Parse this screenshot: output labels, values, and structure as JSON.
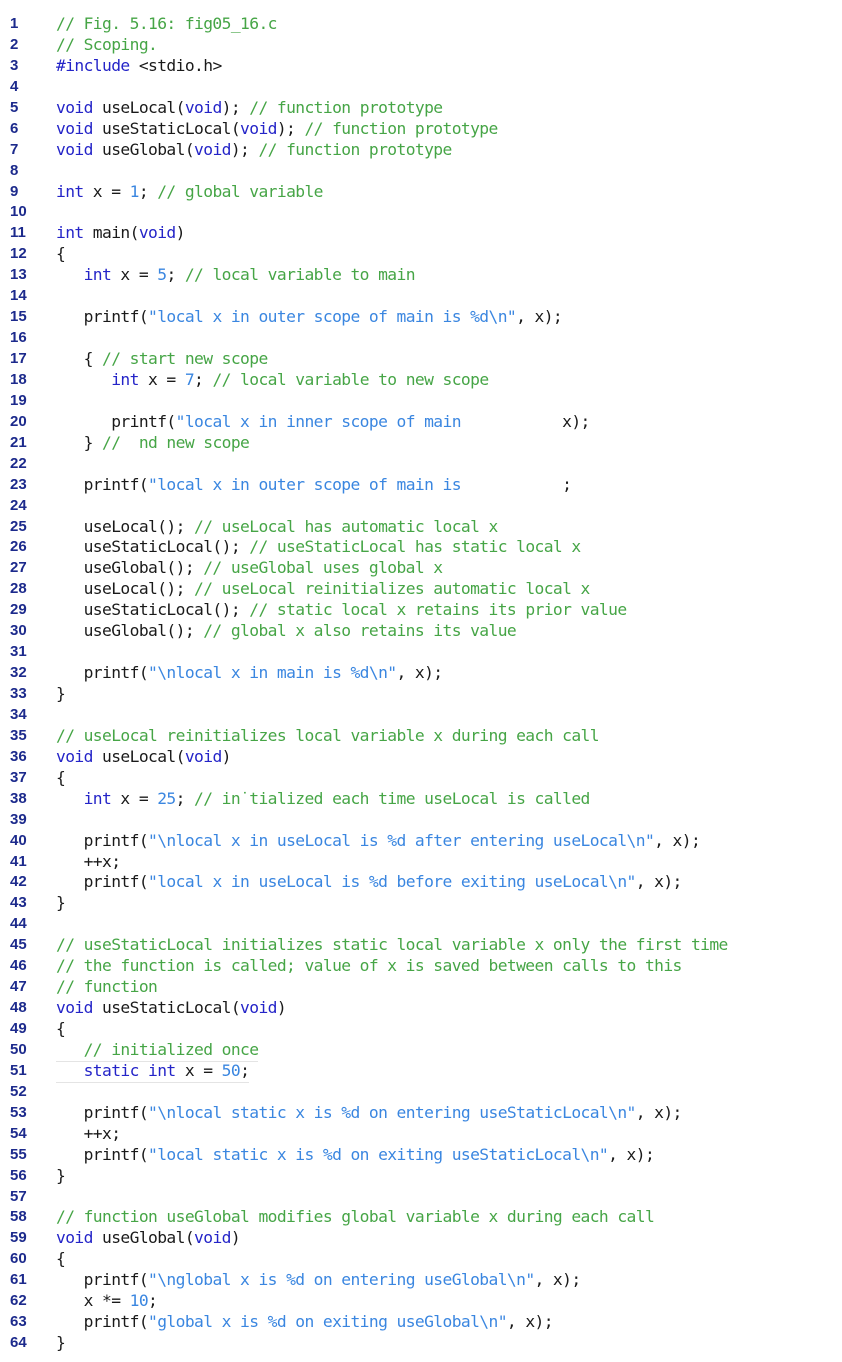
{
  "document": {
    "title": "Fig. 5.16: fig05_16.c — Scoping",
    "lines": [
      {
        "n": "1",
        "tokens": [
          {
            "t": "cm",
            "v": "// Fig. 5.16: fig05_16.c"
          }
        ]
      },
      {
        "n": "2",
        "tokens": [
          {
            "t": "cm",
            "v": "// Scoping."
          }
        ]
      },
      {
        "n": "3",
        "tokens": [
          {
            "t": "pp",
            "v": "#include"
          },
          {
            "t": "",
            "v": " <stdio.h>"
          }
        ]
      },
      {
        "n": "4",
        "tokens": []
      },
      {
        "n": "5",
        "tokens": [
          {
            "t": "kw",
            "v": "void"
          },
          {
            "t": "",
            "v": " useLocal("
          },
          {
            "t": "kw",
            "v": "void"
          },
          {
            "t": "",
            "v": "); "
          },
          {
            "t": "cm",
            "v": "// function prototype"
          }
        ]
      },
      {
        "n": "6",
        "tokens": [
          {
            "t": "kw",
            "v": "void"
          },
          {
            "t": "",
            "v": " useStaticLocal("
          },
          {
            "t": "kw",
            "v": "void"
          },
          {
            "t": "",
            "v": "); "
          },
          {
            "t": "cm",
            "v": "// function prototype"
          }
        ]
      },
      {
        "n": "7",
        "tokens": [
          {
            "t": "kw",
            "v": "void"
          },
          {
            "t": "",
            "v": " useGlobal("
          },
          {
            "t": "kw",
            "v": "void"
          },
          {
            "t": "",
            "v": "); "
          },
          {
            "t": "cm",
            "v": "// function prototype"
          }
        ]
      },
      {
        "n": "8",
        "tokens": []
      },
      {
        "n": "9",
        "tokens": [
          {
            "t": "kw",
            "v": "int"
          },
          {
            "t": "",
            "v": " x = "
          },
          {
            "t": "num",
            "v": "1"
          },
          {
            "t": "",
            "v": "; "
          },
          {
            "t": "cm",
            "v": "// global variable"
          }
        ]
      },
      {
        "n": "10",
        "tokens": []
      },
      {
        "n": "11",
        "tokens": [
          {
            "t": "kw",
            "v": "int"
          },
          {
            "t": "",
            "v": " main("
          },
          {
            "t": "kw",
            "v": "void"
          },
          {
            "t": "",
            "v": ")"
          }
        ]
      },
      {
        "n": "12",
        "tokens": [
          {
            "t": "",
            "v": "{"
          }
        ]
      },
      {
        "n": "13",
        "tokens": [
          {
            "t": "",
            "v": "   "
          },
          {
            "t": "kw",
            "v": "int"
          },
          {
            "t": "",
            "v": " x = "
          },
          {
            "t": "num",
            "v": "5"
          },
          {
            "t": "",
            "v": "; "
          },
          {
            "t": "cm",
            "v": "// local variable to main"
          }
        ]
      },
      {
        "n": "14",
        "tokens": []
      },
      {
        "n": "15",
        "tokens": [
          {
            "t": "",
            "v": "   printf("
          },
          {
            "t": "str",
            "v": "\"local x in outer scope of main is %d\\n\""
          },
          {
            "t": "",
            "v": ", x);"
          }
        ]
      },
      {
        "n": "16",
        "tokens": []
      },
      {
        "n": "17",
        "tokens": [
          {
            "t": "",
            "v": "   { "
          },
          {
            "t": "cm",
            "v": "// start new scope"
          }
        ]
      },
      {
        "n": "18",
        "tokens": [
          {
            "t": "",
            "v": "      "
          },
          {
            "t": "kw",
            "v": "int"
          },
          {
            "t": "",
            "v": " x = "
          },
          {
            "t": "num",
            "v": "7"
          },
          {
            "t": "",
            "v": "; "
          },
          {
            "t": "cm",
            "v": "// local variable to new scope"
          }
        ]
      },
      {
        "n": "19",
        "tokens": []
      },
      {
        "n": "20",
        "tokens": [
          {
            "t": "",
            "v": "      printf("
          },
          {
            "t": "str",
            "v": "\"local x in inner scope of main"
          },
          {
            "t": "",
            "v": "           x);"
          }
        ]
      },
      {
        "n": "21",
        "tokens": [
          {
            "t": "",
            "v": "   } "
          },
          {
            "t": "cm",
            "v": "//  nd new scope"
          }
        ]
      },
      {
        "n": "22",
        "tokens": []
      },
      {
        "n": "23",
        "tokens": [
          {
            "t": "",
            "v": "   printf("
          },
          {
            "t": "str",
            "v": "\"local x in outer scope of main is"
          },
          {
            "t": "",
            "v": "           ;"
          }
        ]
      },
      {
        "n": "24",
        "tokens": []
      },
      {
        "n": "25",
        "tokens": [
          {
            "t": "",
            "v": "   useLocal(); "
          },
          {
            "t": "cm",
            "v": "// useLocal has automatic local x"
          }
        ]
      },
      {
        "n": "26",
        "tokens": [
          {
            "t": "",
            "v": "   useStaticLocal(); "
          },
          {
            "t": "cm",
            "v": "// useStaticLocal has static local x"
          }
        ]
      },
      {
        "n": "27",
        "tokens": [
          {
            "t": "",
            "v": "   useGlobal(); "
          },
          {
            "t": "cm",
            "v": "// useGlobal uses global x"
          }
        ]
      },
      {
        "n": "28",
        "tokens": [
          {
            "t": "",
            "v": "   useLocal(); "
          },
          {
            "t": "cm",
            "v": "// useLocal reinitializes automatic local x"
          }
        ]
      },
      {
        "n": "29",
        "tokens": [
          {
            "t": "",
            "v": "   useStaticLocal(); "
          },
          {
            "t": "cm",
            "v": "// static local x retains its prior value"
          }
        ]
      },
      {
        "n": "30",
        "tokens": [
          {
            "t": "",
            "v": "   useGlobal(); "
          },
          {
            "t": "cm",
            "v": "// global x also retains its value"
          }
        ]
      },
      {
        "n": "31",
        "tokens": []
      },
      {
        "n": "32",
        "tokens": [
          {
            "t": "",
            "v": "   printf("
          },
          {
            "t": "str",
            "v": "\"\\nlocal x in main is %d\\n\""
          },
          {
            "t": "",
            "v": ", x);"
          }
        ]
      },
      {
        "n": "33",
        "tokens": [
          {
            "t": "",
            "v": "}"
          }
        ]
      },
      {
        "n": "34",
        "tokens": []
      },
      {
        "n": "35",
        "tokens": [
          {
            "t": "cm",
            "v": "// useLocal reinitializes local variable x during each call"
          }
        ]
      },
      {
        "n": "36",
        "tokens": [
          {
            "t": "kw",
            "v": "void"
          },
          {
            "t": "",
            "v": " useLocal("
          },
          {
            "t": "kw",
            "v": "void"
          },
          {
            "t": "",
            "v": ")"
          }
        ]
      },
      {
        "n": "37",
        "tokens": [
          {
            "t": "",
            "v": "{"
          }
        ]
      },
      {
        "n": "38",
        "tokens": [
          {
            "t": "",
            "v": "   "
          },
          {
            "t": "kw",
            "v": "int"
          },
          {
            "t": "",
            "v": " x = "
          },
          {
            "t": "num",
            "v": "25"
          },
          {
            "t": "",
            "v": "; "
          },
          {
            "t": "cm",
            "v": "// in˙tialized each time useLocal is called"
          }
        ]
      },
      {
        "n": "39",
        "tokens": []
      },
      {
        "n": "40",
        "tokens": [
          {
            "t": "",
            "v": "   printf("
          },
          {
            "t": "str",
            "v": "\"\\nlocal x in useLocal is %d after entering useLocal\\n\""
          },
          {
            "t": "",
            "v": ", x);"
          }
        ]
      },
      {
        "n": "41",
        "tokens": [
          {
            "t": "",
            "v": "   ++x;"
          }
        ]
      },
      {
        "n": "42",
        "tokens": [
          {
            "t": "",
            "v": "   printf("
          },
          {
            "t": "str",
            "v": "\"local x in useLocal is %d before exiting useLocal\\n\""
          },
          {
            "t": "",
            "v": ", x);"
          }
        ]
      },
      {
        "n": "43",
        "tokens": [
          {
            "t": "",
            "v": "}"
          }
        ]
      },
      {
        "n": "44",
        "tokens": []
      },
      {
        "n": "45",
        "tokens": [
          {
            "t": "cm",
            "v": "// useStaticLocal initializes static local variable x only the first time"
          }
        ]
      },
      {
        "n": "46",
        "tokens": [
          {
            "t": "cm",
            "v": "// the function is called; value of x is saved between calls to this"
          }
        ]
      },
      {
        "n": "47",
        "tokens": [
          {
            "t": "cm",
            "v": "// function"
          }
        ]
      },
      {
        "n": "48",
        "tokens": [
          {
            "t": "kw",
            "v": "void"
          },
          {
            "t": "",
            "v": " useStaticLocal("
          },
          {
            "t": "kw",
            "v": "void"
          },
          {
            "t": "",
            "v": ")"
          }
        ]
      },
      {
        "n": "49",
        "tokens": [
          {
            "t": "",
            "v": "{"
          }
        ]
      },
      {
        "n": "50",
        "tokens": [
          {
            "t": "",
            "v": "   "
          },
          {
            "t": "cm",
            "v": "// initialized once"
          }
        ]
      },
      {
        "n": "51",
        "tokens": [
          {
            "t": "",
            "v": "   "
          },
          {
            "t": "kw",
            "v": "static int"
          },
          {
            "t": "",
            "v": " x = "
          },
          {
            "t": "num",
            "v": "50"
          },
          {
            "t": "",
            "v": ";"
          }
        ]
      },
      {
        "n": "52",
        "tokens": []
      },
      {
        "n": "53",
        "tokens": [
          {
            "t": "",
            "v": "   printf("
          },
          {
            "t": "str",
            "v": "\"\\nlocal static x is %d on entering useStaticLocal\\n\""
          },
          {
            "t": "",
            "v": ", x);"
          }
        ]
      },
      {
        "n": "54",
        "tokens": [
          {
            "t": "",
            "v": "   ++x;"
          }
        ]
      },
      {
        "n": "55",
        "tokens": [
          {
            "t": "",
            "v": "   printf("
          },
          {
            "t": "str",
            "v": "\"local static x is %d on exiting useStaticLocal\\n\""
          },
          {
            "t": "",
            "v": ", x);"
          }
        ]
      },
      {
        "n": "56",
        "tokens": [
          {
            "t": "",
            "v": "}"
          }
        ]
      },
      {
        "n": "57",
        "tokens": []
      },
      {
        "n": "58",
        "tokens": [
          {
            "t": "cm",
            "v": "// function useGlobal modifies global variable x during each call"
          }
        ]
      },
      {
        "n": "59",
        "tokens": [
          {
            "t": "kw",
            "v": "void"
          },
          {
            "t": "",
            "v": " useGlobal("
          },
          {
            "t": "kw",
            "v": "void"
          },
          {
            "t": "",
            "v": ")"
          }
        ]
      },
      {
        "n": "60",
        "tokens": [
          {
            "t": "",
            "v": "{"
          }
        ]
      },
      {
        "n": "61",
        "tokens": [
          {
            "t": "",
            "v": "   printf("
          },
          {
            "t": "str",
            "v": "\"\\nglobal x is %d on entering useGlobal\\n\""
          },
          {
            "t": "",
            "v": ", x);"
          }
        ]
      },
      {
        "n": "62",
        "tokens": [
          {
            "t": "",
            "v": "   x *= "
          },
          {
            "t": "num",
            "v": "10"
          },
          {
            "t": "",
            "v": ";"
          }
        ]
      },
      {
        "n": "63",
        "tokens": [
          {
            "t": "",
            "v": "   printf("
          },
          {
            "t": "str",
            "v": "\"global x is %d on exiting useGlobal\\n\""
          },
          {
            "t": "",
            "v": ", x);"
          }
        ]
      },
      {
        "n": "64",
        "tokens": [
          {
            "t": "",
            "v": "}"
          }
        ]
      }
    ]
  },
  "colors": {
    "line_number": "#1c2a8c",
    "keyword": "#2424c8",
    "string": "#3a86e0",
    "comment": "#46a546",
    "text": "#1a1a1a"
  }
}
